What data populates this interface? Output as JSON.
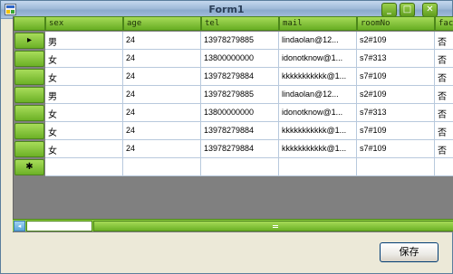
{
  "window": {
    "title": "Form1",
    "min_icon": "minimize-icon",
    "max_icon": "maximize-icon",
    "close_icon": "close-icon"
  },
  "grid": {
    "columns": [
      "sex",
      "age",
      "tel",
      "mail",
      "roomNo",
      "fac"
    ],
    "rows": [
      [
        "男",
        "24",
        "13978279885",
        "lindaolan@12...",
        "s2#109",
        "否"
      ],
      [
        "女",
        "24",
        "13800000000",
        "idonotknow@1...",
        "s7#313",
        "否"
      ],
      [
        "女",
        "24",
        "13978279884",
        "kkkkkkkkkkk@1...",
        "s7#109",
        "否"
      ],
      [
        "男",
        "24",
        "13978279885",
        "lindaolan@12...",
        "s2#109",
        "否"
      ],
      [
        "女",
        "24",
        "13800000000",
        "idonotknow@1...",
        "s7#313",
        "否"
      ],
      [
        "女",
        "24",
        "13978279884",
        "kkkkkkkkkkk@1...",
        "s7#109",
        "否"
      ],
      [
        "女",
        "24",
        "13978279884",
        "kkkkkkkkkkk@1...",
        "s7#109",
        "否"
      ]
    ],
    "current_row_marker": "▸",
    "new_row_marker": "✱"
  },
  "actions": {
    "save_label": "保存"
  },
  "colors": {
    "header_green": "#7fc13a",
    "grid_background": "#808080",
    "title_bar": "#a9c1dd"
  }
}
